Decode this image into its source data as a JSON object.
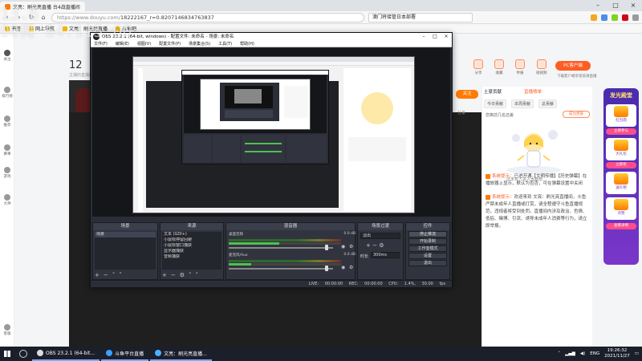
{
  "browser": {
    "tab_title": "文亮：刷光亮直播 台4战直播间",
    "url_host": "https://www.douyu.com/",
    "url_path": "18222167_r=0.8207146834763837",
    "search_text": "澳门将接管日本部署",
    "bookmarks": [
      "书签",
      "网上导航",
      "文亮：刷光亮直播",
      "斗鱼吧"
    ]
  },
  "sidebar": {
    "items": [
      "关注",
      "排行榜",
      "推荐",
      "赛事",
      "游戏",
      "大神",
      "客服"
    ]
  },
  "streamer": {
    "followers": "12",
    "sub": "主播的直播间",
    "icons": [
      {
        "label": "分享",
        "icon": "share-icon"
      },
      {
        "label": "收藏",
        "icon": "star-icon"
      },
      {
        "label": "举报",
        "icon": "report-icon"
      },
      {
        "label": "短视频",
        "icon": "video-icon"
      },
      {
        "label": "主播",
        "icon": "mic-icon"
      }
    ],
    "pc_button": "PC客户端",
    "pc_sub": "下载客户端享受高清直播",
    "follow": "关注",
    "share": "分享"
  },
  "chat": {
    "contribute": "土豪贡献",
    "room_rank": "直播榜单",
    "tabs": [
      "今日贡献",
      "本周贡献",
      "总贡献"
    ],
    "rank_tip": "您离前几名还差",
    "rank_btn": "成为贵族",
    "mascot_caption": "还未有人进入贡献榜",
    "messages": [
      {
        "prefix": "系统提示：",
        "text": "已进开通【文明传播】【历史弹幕】在播放器上显示，默认为否否，可在弹幕设置中关闭"
      },
      {
        "prefix": "系统提示：",
        "text": "欢迎来到 文亮：刷光亮直播间，斗鱼严禁未成年人直播或打赏，请全程遵守斗鱼直播规范，违规者将受到处罚。直播间内涉及政治、色情、低俗、赌博、引流、诱导未成年人消费等行为，请立即举报。"
      }
    ]
  },
  "promo": {
    "title": "发光殿堂",
    "cards": [
      "红包雨",
      "大礼包",
      "送礼物",
      "点赞"
    ],
    "pills": [
      "立即参与",
      "立即抢",
      "查看详情"
    ]
  },
  "obs": {
    "title": "OBS 23.2.1 (64-bit, windows) - 配置文件: 未命名 - 场景: 未命名",
    "menu": [
      "文件(F)",
      "编辑(E)",
      "视图(V)",
      "配置文件(P)",
      "场景集合(S)",
      "工具(T)",
      "帮助(H)"
    ],
    "docks": {
      "scenes": {
        "title": "场景",
        "items": [
          "场景"
        ]
      },
      "sources": {
        "title": "来源",
        "items": [
          "文本 (GDI+)",
          "小鼠标停留回避",
          "小鼠标窗口捕获",
          "显示器捕获",
          "音频捕获"
        ]
      },
      "mixer": {
        "title": "混音器",
        "rows": [
          {
            "name": "桌面音频",
            "db": "0.0 dB"
          },
          {
            "name": "麦克风/Aux",
            "db": "0.0 dB"
          }
        ]
      },
      "transitions": {
        "title": "场景过渡",
        "type": "淡出",
        "duration_label": "时长",
        "duration": "300ms"
      },
      "controls": {
        "title": "控件",
        "buttons": [
          "停止推流",
          "开始录制",
          "工作室模式",
          "设置",
          "退出"
        ]
      }
    },
    "status": "LIVE: 00:00:00   REC: 00:00:00   CPU: 1.4%, 30.00 fps"
  },
  "taskbar": {
    "apps": [
      "OBS 23.2.1 (64-bit...",
      "斗鱼平台直播",
      "文亮：刷光亮直播..."
    ],
    "lang": "ENG",
    "time": "19:26:32",
    "date": "2021/11/27"
  },
  "watermark": {
    "line1": "13.6",
    "line2": "00舞 64.115.00"
  },
  "colors": {
    "douyu_orange": "#ff7a00",
    "douyu_accent": "#ff5d23",
    "obs_bg": "#2b2e38",
    "taskbar": "#1b1f2a"
  }
}
